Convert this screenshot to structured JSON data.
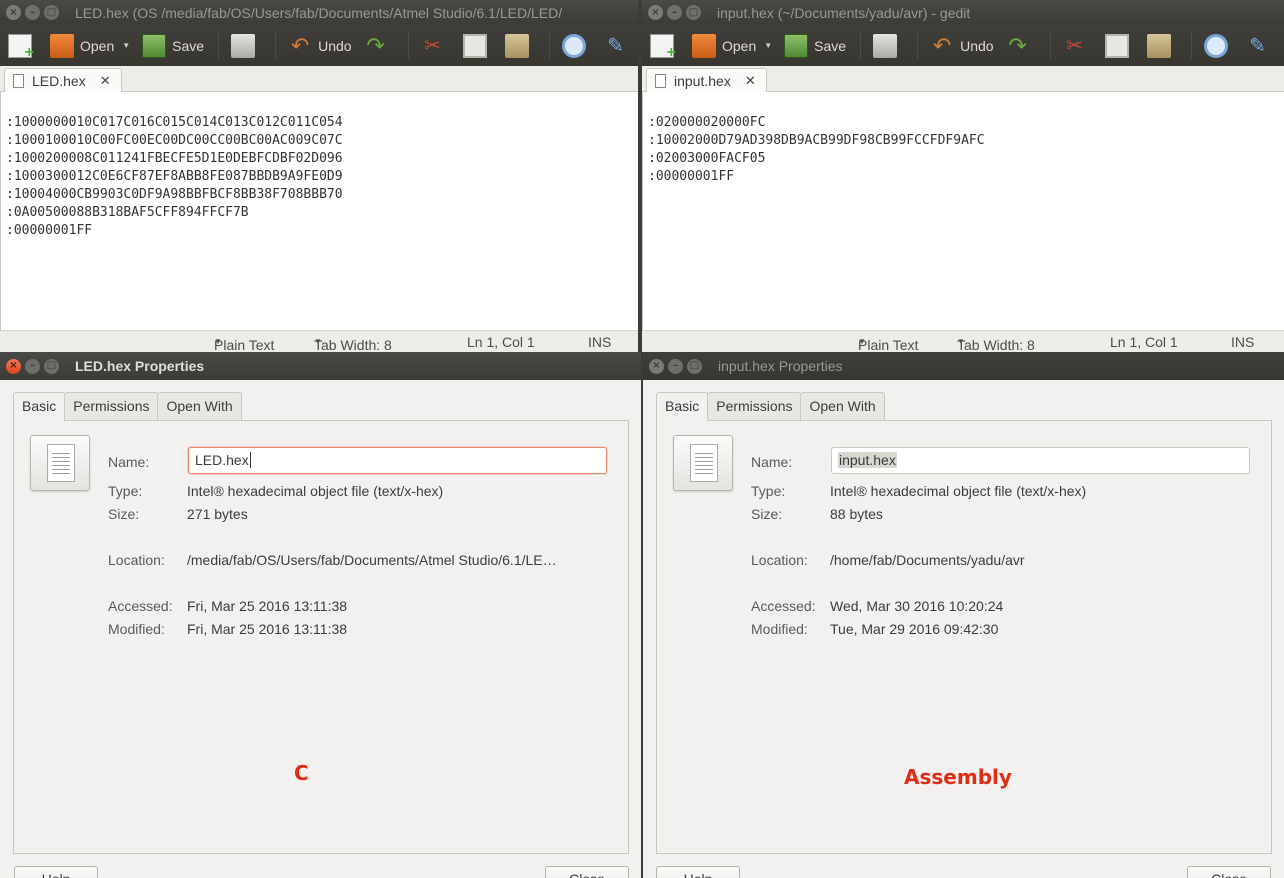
{
  "left_editor": {
    "window_title": "LED.hex (OS /media/fab/OS/Users/fab/Documents/Atmel Studio/6.1/LED/LED/",
    "toolbar": {
      "open": "Open",
      "save": "Save",
      "undo": "Undo"
    },
    "tab_label": "LED.hex",
    "lines": [
      ":1000000010C017C016C015C014C013C012C011C054",
      ":1000100010C00FC00EC00DC00CC00BC00AC009C07C",
      ":1000200008C011241FBECFE5D1E0DEBFCDBF02D096",
      ":1000300012C0E6CF87EF8ABB8FE087BBDB9A9FE0D9",
      ":10004000CB9903C0DF9A98BBFBCF8BB38F708BBB70",
      ":0A00500088B318BAF5CFF894FFCF7B",
      ":00000001FF"
    ],
    "status": {
      "language": "Plain Text",
      "tab_width": "Tab Width: 8",
      "position": "Ln 1, Col 1",
      "mode": "INS"
    }
  },
  "right_editor": {
    "window_title": "input.hex (~/Documents/yadu/avr) - gedit",
    "toolbar": {
      "open": "Open",
      "save": "Save",
      "undo": "Undo"
    },
    "tab_label": "input.hex",
    "lines": [
      ":020000020000FC",
      ":10002000D79AD398DB9ACB99DF98CB99FCCFDF9AFC",
      ":02003000FACF05",
      ":00000001FF"
    ],
    "status": {
      "language": "Plain Text",
      "tab_width": "Tab Width: 8",
      "position": "Ln 1, Col 1",
      "mode": "INS"
    }
  },
  "left_dialog": {
    "title": "LED.hex Properties",
    "tabs": [
      "Basic",
      "Permissions",
      "Open With"
    ],
    "labels": {
      "name": "Name:",
      "type": "Type:",
      "size": "Size:",
      "location": "Location:",
      "accessed": "Accessed:",
      "modified": "Modified:"
    },
    "name": "LED.hex",
    "type": "Intel® hexadecimal object file (text/x-hex)",
    "size": "271 bytes",
    "location": "/media/fab/OS/Users/fab/Documents/Atmel Studio/6.1/LE…",
    "accessed": "Fri, Mar 25 2016 13:11:38",
    "modified": "Fri, Mar 25 2016 13:11:38",
    "annotation": "C",
    "help": "Help",
    "close": "Close"
  },
  "right_dialog": {
    "title": "input.hex Properties",
    "tabs": [
      "Basic",
      "Permissions",
      "Open With"
    ],
    "labels": {
      "name": "Name:",
      "type": "Type:",
      "size": "Size:",
      "location": "Location:",
      "accessed": "Accessed:",
      "modified": "Modified:"
    },
    "name": "input.hex",
    "type": "Intel® hexadecimal object file (text/x-hex)",
    "size": "88 bytes",
    "location": "/home/fab/Documents/yadu/avr",
    "accessed": "Wed, Mar 30 2016 10:20:24",
    "modified": "Tue, Mar 29 2016 09:42:30",
    "annotation": "Assembly",
    "help": "Help",
    "close": "Close"
  },
  "colors": {
    "annotation": "#e02c14",
    "titlebar": "#3c3b37",
    "close_button_active": "#de4815"
  }
}
